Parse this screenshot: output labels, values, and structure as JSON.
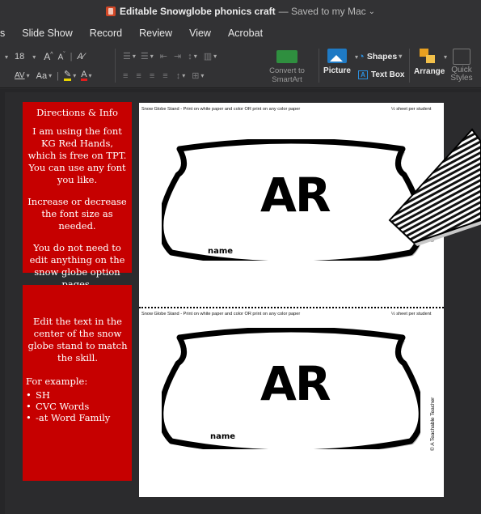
{
  "window": {
    "file_name": "Editable Snowglobe phonics craft",
    "saved_status": "— Saved to my Mac"
  },
  "ribbon_tabs": [
    "s",
    "Slide Show",
    "Record",
    "Review",
    "View",
    "Acrobat"
  ],
  "ribbon": {
    "font_size": "18",
    "convert_smartart": "Convert to SmartArt",
    "picture": "Picture",
    "text_box": "Text Box",
    "shapes": "Shapes",
    "arrange": "Arrange",
    "quick_styles": "Quick Styles",
    "colors": {
      "accent_green": "#2f8f3f",
      "picture_blue": "#1f7ac4"
    }
  },
  "info_box_1": {
    "title": "Directions & Info",
    "paragraphs": [
      "I am using the font KG Red Hands, which is free on TPT. You can use any font you like.",
      "Increase or decrease the font size as needed.",
      "You do not need to edit anything on the snow globe option pages."
    ],
    "color": "#c60000"
  },
  "info_box_2": {
    "paragraph": "Edit the text in the center of the snow globe stand to match the skill.",
    "lead": "For example:",
    "examples": [
      "SH",
      "CVC Words",
      "-at Word Family"
    ]
  },
  "page": {
    "header_left": "Snow Globe Stand - Print on white paper and color OR print on any color paper",
    "header_right": "½ sheet per student",
    "skill_text": "AR",
    "name_label": "name",
    "credit": "© A Teachable Teacher"
  }
}
